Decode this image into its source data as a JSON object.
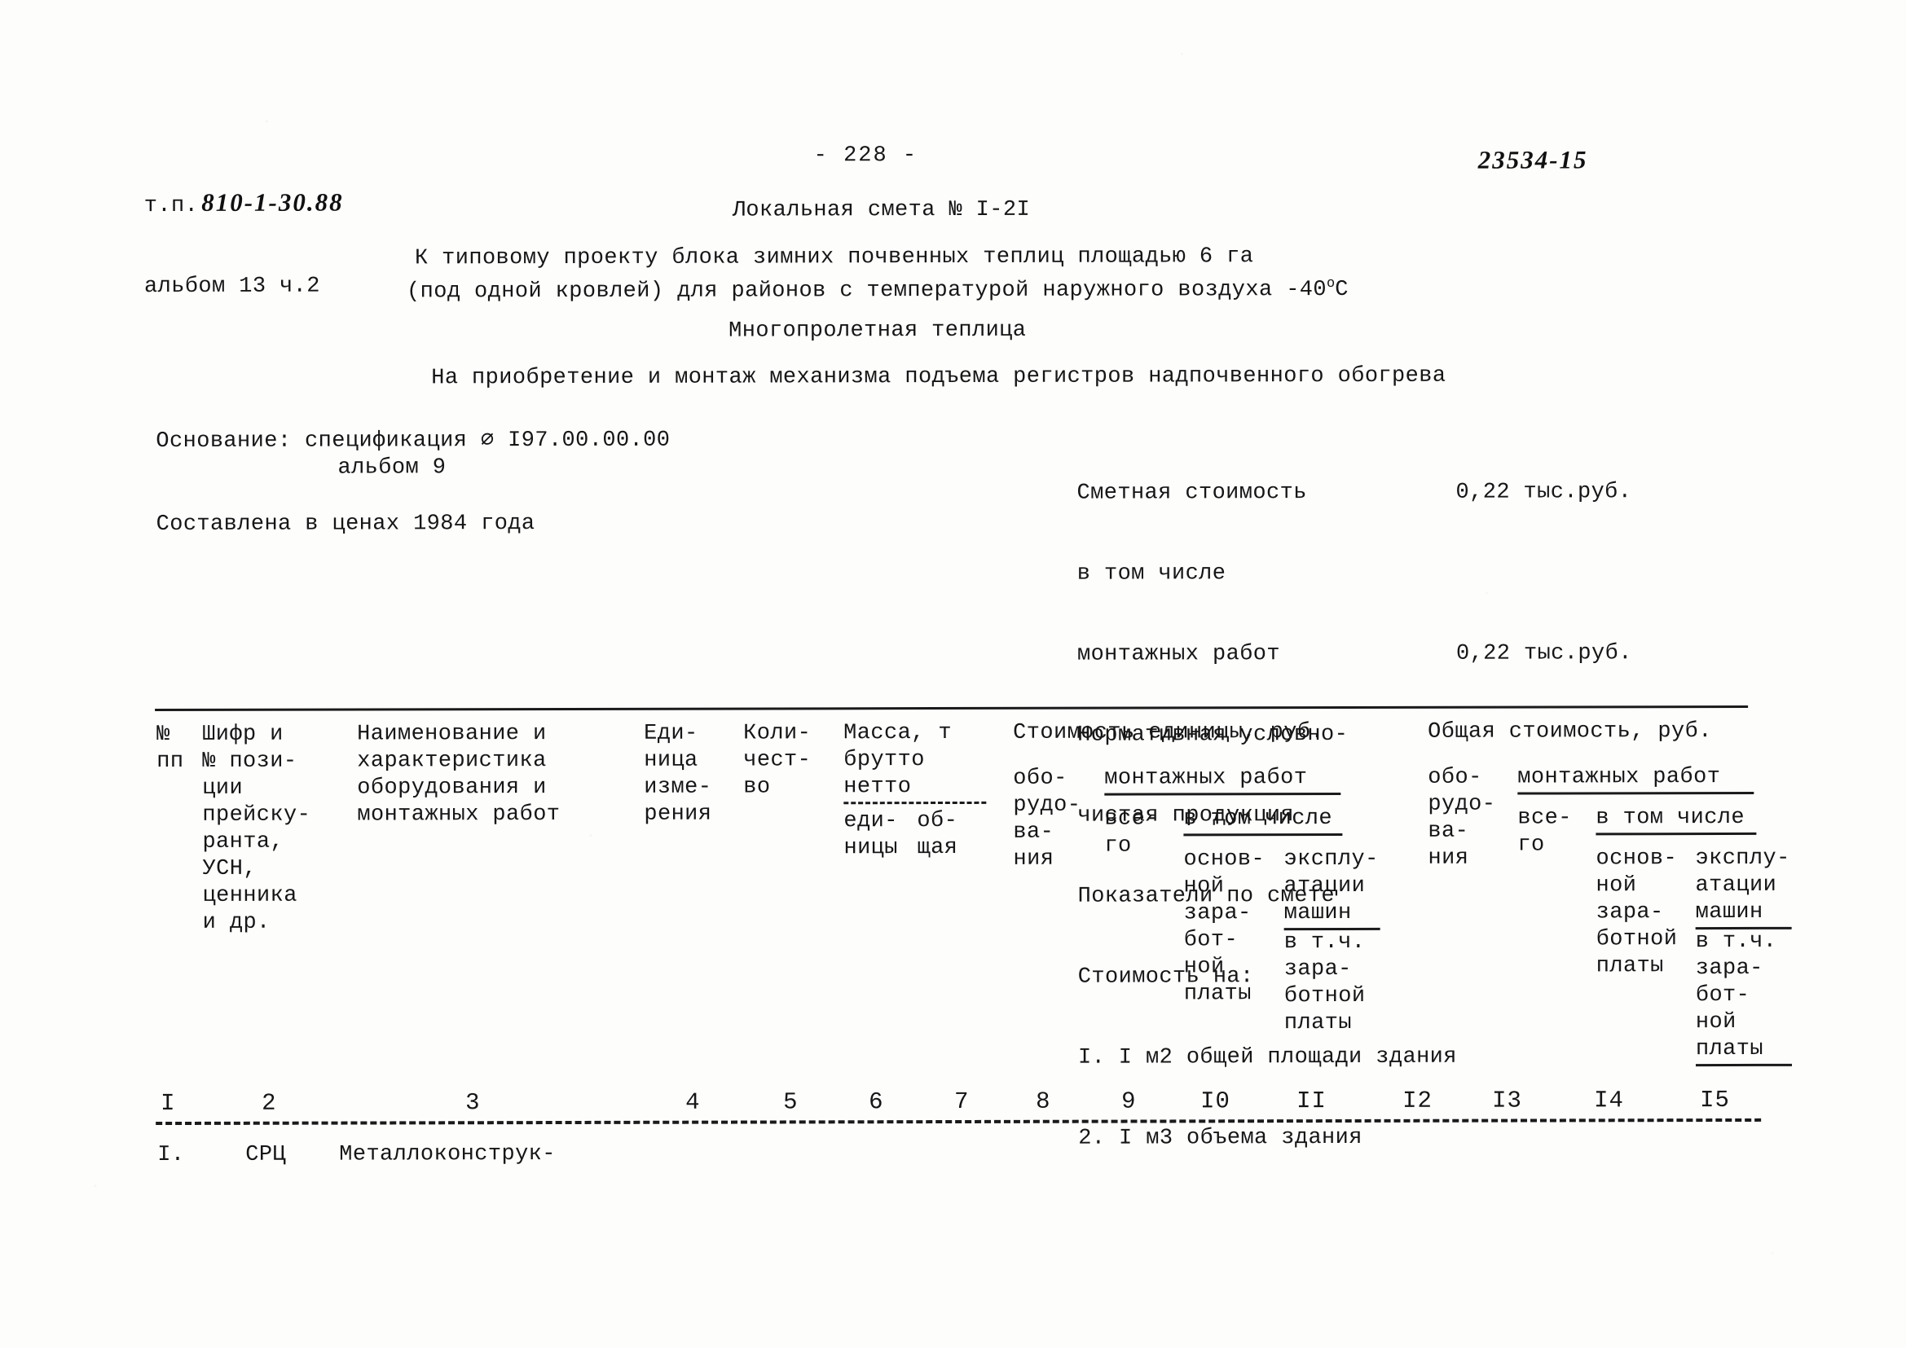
{
  "header": {
    "project_label": "т.п.",
    "project_code": "810-1-30.88",
    "album_line": "альбом 13 ч.2",
    "page_number": "- 228 -",
    "doc_number": "23534-15"
  },
  "title": {
    "estimate": "Локальная смета № I-2I",
    "subtitle_line1": "К типовому проекту блока зимних почвенных теплиц площадью 6 га",
    "subtitle_line2_a": "(под одной кровлей) для районов с температурой наружного воздуха -40",
    "subtitle_line2_deg": "о",
    "subtitle_line2_b": "С",
    "greenhouse_type": "Многопролетная теплица",
    "purpose": "На приобретение и монтаж механизма подъема регистров надпочвенного обогрева"
  },
  "basis": {
    "line1": "Основание: спецификация ∅ I97.00.00.00",
    "line2": "альбом 9",
    "prices": "Составлена в ценах 1984 года"
  },
  "summary": {
    "rows": [
      {
        "label": "Сметная стоимость",
        "value": "0,22 тыс.руб."
      },
      {
        "label": "в том числе",
        "value": ""
      },
      {
        "label": "монтажных работ",
        "value": "0,22 тыс.руб."
      },
      {
        "label": "Нормативная условно-",
        "value": ""
      },
      {
        "label": "чистая продукция",
        "value": ""
      },
      {
        "label": "Показатели по смете",
        "value": ""
      },
      {
        "label": "Стоимость на:",
        "value": ""
      },
      {
        "label": "I. I м2 общей площади здания",
        "value": ""
      },
      {
        "label": "2. I м3 объема здания",
        "value": ""
      }
    ]
  },
  "table": {
    "col1": [
      "№",
      "пп"
    ],
    "col2": [
      "Шифр и",
      "№ пози-",
      "ции",
      "прейску-",
      "ранта,",
      "УСН,",
      "ценника",
      "и др."
    ],
    "col3": [
      "Наименование и",
      "характеристика",
      "оборудования и",
      "монтажных работ"
    ],
    "col4": [
      "Еди-",
      "ница",
      "изме-",
      "рения"
    ],
    "col5": [
      "Коли-",
      "чест-",
      "во"
    ],
    "mass_group": {
      "title": "Масса, т",
      "brutto": "брутто",
      "netto": "нетто",
      "sub_unit": [
        "еди-",
        "ницы"
      ],
      "sub_total": [
        "об-",
        "щая"
      ]
    },
    "unit_cost_group": {
      "title": "Стоимость единицы, руб.",
      "equipment": [
        "обо-",
        "рудо-",
        "ва-",
        "ния"
      ],
      "install_title": "монтажных работ",
      "total": [
        "все-",
        "го"
      ],
      "incl_title": "в том числе",
      "basic_wage": [
        "основ-",
        "ной",
        "зара-",
        "бот-",
        "ной",
        "платы"
      ],
      "machines": [
        "эксплу-",
        "атации",
        "машин",
        "в т.ч.",
        "зара-",
        "ботной",
        "платы"
      ]
    },
    "total_cost_group": {
      "title": "Общая стоимость, руб.",
      "equipment": [
        "обо-",
        "рудо-",
        "ва-",
        "ния"
      ],
      "install_title": "монтажных работ",
      "total": [
        "все-",
        "го"
      ],
      "incl_title": "в том числе",
      "basic_wage": [
        "основ-",
        "ной",
        "зара-",
        "ботной",
        "платы"
      ],
      "machines": [
        "эксплу-",
        "атации",
        "машин",
        "в т.ч.",
        "зара-",
        "бот-",
        "ной",
        "платы"
      ]
    },
    "column_numbers": [
      "I",
      "2",
      "3",
      "4",
      "5",
      "6",
      "7",
      "8",
      "9",
      "I0",
      "II",
      "I2",
      "I3",
      "I4",
      "I5"
    ]
  },
  "rows": [
    {
      "num": "I.",
      "code": "СРЦ",
      "name": "Металлоконструк-"
    }
  ]
}
